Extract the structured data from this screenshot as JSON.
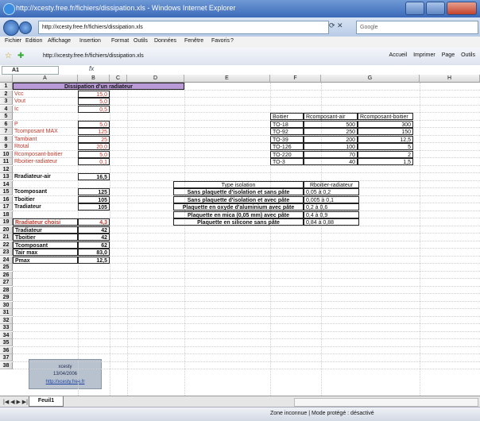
{
  "window": {
    "title": "http://xcesty.free.fr/fichiers/dissipation.xls - Windows Internet Explorer"
  },
  "nav": {
    "address": "http://xcesty.free.fr/fichiers/dissipation.xls",
    "search_placeholder": "Google"
  },
  "menu": [
    "Fichier",
    "Edition",
    "Affichage",
    "Insertion",
    "Format",
    "Outils",
    "Données",
    "Fenêtre",
    "Favoris",
    "?"
  ],
  "favbar": {
    "tab_title": "http://xcesty.free.fr/fichiers/dissipation.xls",
    "tools": [
      "Accueil",
      "Imprimer",
      "Page",
      "Outils"
    ]
  },
  "formula": {
    "cell_ref": "A1",
    "fx": "fx"
  },
  "columns": [
    "A",
    "B",
    "C",
    "D",
    "E",
    "F",
    "G",
    "H"
  ],
  "rows": [
    "1",
    "2",
    "3",
    "4",
    "5",
    "6",
    "7",
    "8",
    "9",
    "10",
    "11",
    "12",
    "13",
    "14",
    "15",
    "16",
    "17",
    "18",
    "19",
    "20",
    "21",
    "22",
    "23",
    "24",
    "25",
    "26",
    "27",
    "28",
    "29",
    "30",
    "31",
    "32",
    "33",
    "34",
    "35",
    "36",
    "37",
    "38"
  ],
  "sheet": {
    "title": "Dissipation d'un radiateur",
    "params": [
      {
        "row": 2,
        "label": "Vcc",
        "value": "15,0"
      },
      {
        "row": 3,
        "label": "Vout",
        "value": "5,0"
      },
      {
        "row": 4,
        "label": "Ic",
        "value": "0,5"
      },
      {
        "row": 6,
        "label": "P",
        "value": "5,0"
      },
      {
        "row": 7,
        "label": "Tcomposant MAX",
        "value": "125"
      },
      {
        "row": 8,
        "label": "Tambiant",
        "value": "25"
      },
      {
        "row": 9,
        "label": "Rtotal",
        "value": "20,0"
      },
      {
        "row": 10,
        "label": "Rcomposant-boitier",
        "value": "5,0"
      },
      {
        "row": 11,
        "label": "Rboitier-radiateur",
        "value": "0,1"
      }
    ],
    "rad_air": {
      "label": "Rradiateur-air",
      "value": "16,5"
    },
    "temps": [
      {
        "row": 15,
        "label": "Tcomposant",
        "value": "125"
      },
      {
        "row": 16,
        "label": "Tboitier",
        "value": "105"
      },
      {
        "row": 17,
        "label": "Tradiateur",
        "value": "105"
      }
    ],
    "choice": [
      {
        "row": 19,
        "label": "Rradiateur choisi",
        "value": "4,3",
        "red": true
      },
      {
        "row": 20,
        "label": "Tradiateur",
        "value": "42"
      },
      {
        "row": 21,
        "label": "Tboitier",
        "value": "42"
      },
      {
        "row": 22,
        "label": "Tcomposant",
        "value": "62"
      },
      {
        "row": 23,
        "label": "Tair max",
        "value": "83,0"
      },
      {
        "row": 24,
        "label": "Pmax",
        "value": "12,5"
      }
    ],
    "boitiers": {
      "headers": [
        "Boitier",
        "Rcomposant-air",
        "Rcomposant-boitier"
      ],
      "rows": [
        [
          "TO-18",
          "500",
          "300"
        ],
        [
          "TO-92",
          "250",
          "150"
        ],
        [
          "TO-39",
          "200",
          "12,5"
        ],
        [
          "TO-126",
          "100",
          "5"
        ],
        [
          "TO-220",
          "70",
          "2"
        ],
        [
          "TO-3",
          "40",
          "1,5"
        ]
      ]
    },
    "isolation": {
      "headers": [
        "Type isolation",
        "Rboitier-radiateur"
      ],
      "rows": [
        [
          "Sans plaquette d'isolation et sans pâte",
          "0,05 à 0,2"
        ],
        [
          "Sans plaquette d'isolation et avec pâte",
          "0,005 à 0,1"
        ],
        [
          "Plaquette en oxyde d'aluminium avec pâte",
          "0,2 à 0,6"
        ],
        [
          "Plaquette en mica (0,05 mm) avec pâte",
          "0,4 à 0,9"
        ],
        [
          "Plaquette en silicone sans pâte",
          "0,84 à 0,88"
        ]
      ]
    },
    "logo": {
      "line1": "xcesty",
      "line2": "13/04/2006",
      "line3": "http://xcesty.free.fr"
    }
  },
  "tabs": {
    "sheet": "Feuil1",
    "nav": "|◀ ◀ ▶ ▶|"
  },
  "status": {
    "text": "Zone inconnue | Mode protégé : désactivé"
  }
}
